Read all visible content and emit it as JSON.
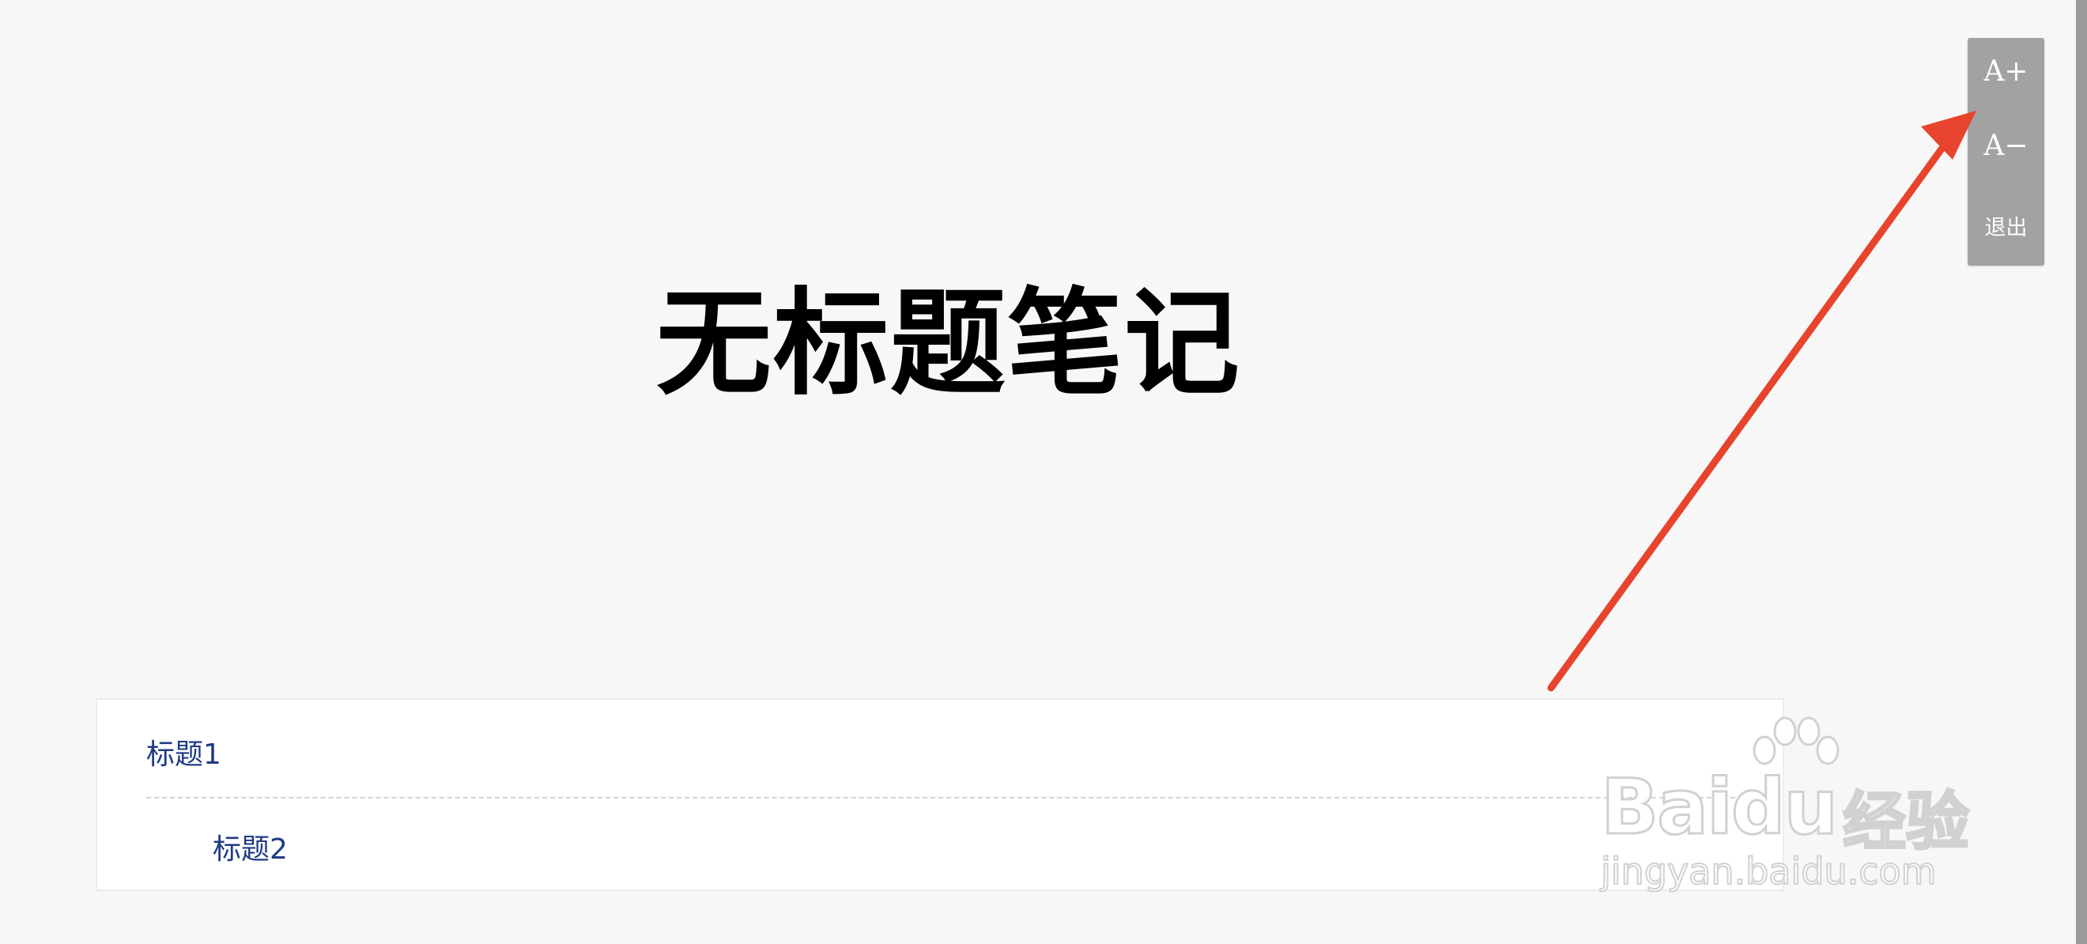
{
  "note": {
    "title": "无标题笔记"
  },
  "toc": {
    "items": [
      {
        "label": "标题1",
        "level": 1
      },
      {
        "label": "标题2",
        "level": 2
      }
    ]
  },
  "tools": {
    "font_increase": "A+",
    "font_decrease": "A−",
    "exit": "退出"
  },
  "watermark": {
    "brand": "Bai",
    "brand_suffix": "du",
    "product": "经验",
    "url": "jingyan.baidu.com"
  },
  "colors": {
    "background": "#f7f7f7",
    "toc_link": "#1f3b82",
    "tool_panel": "#a2a2a2",
    "annotation_arrow": "#e8432c"
  },
  "icons": {
    "annotation": "arrow-pointer-icon",
    "watermark_logo": "baidu-paw-icon"
  }
}
